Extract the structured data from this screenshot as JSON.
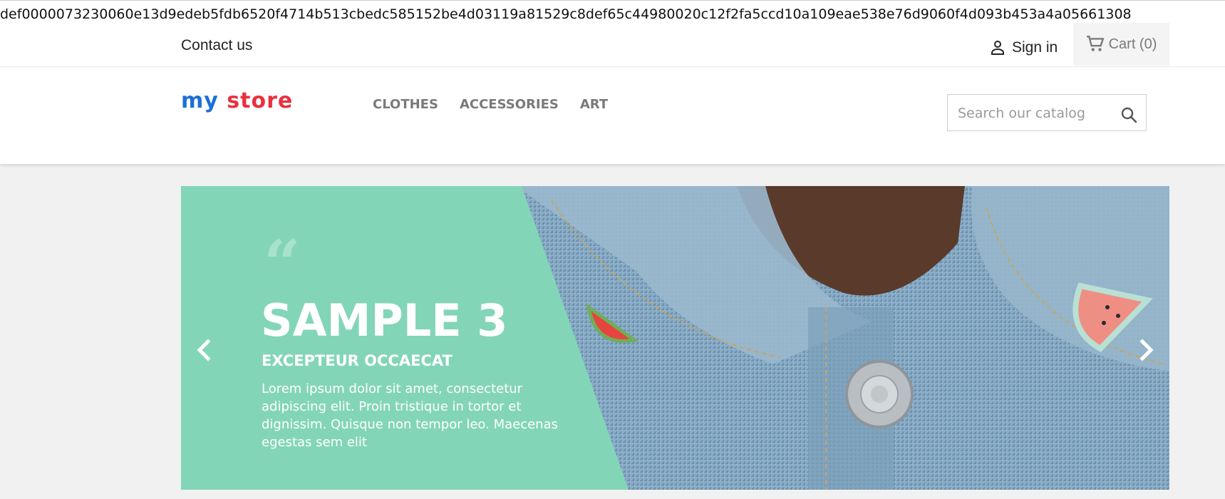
{
  "url_bar": {
    "text": "def0000073230060e13d9edeb5fdb6520f4714b513cbedc585152be4d03119a81529c8def65c44980020c12f2fa5ccd10a109eae538e76d9060f4d093b453a4a05661308"
  },
  "top_nav": {
    "contact_label": "Contact us",
    "signin_label": "Sign in",
    "cart_label": "Cart (0)"
  },
  "header": {
    "logo_part1": "my",
    "logo_part2": "store",
    "menu": [
      "CLOTHES",
      "ACCESSORIES",
      "ART"
    ],
    "search_placeholder": "Search our catalog"
  },
  "slider": {
    "title": "SAMPLE 3",
    "subtitle": "EXCEPTEUR OCCAECAT",
    "description": "Lorem ipsum dolor sit amet, consectetur adipiscing elit. Proin tristique in tortor et dignissim. Quisque non tempor leo. Maecenas egestas sem elit",
    "quote_glyph": "“"
  },
  "colors": {
    "accent_green": "#83d5b8",
    "logo_blue": "#1b6fd8",
    "logo_red": "#e9303e"
  },
  "icons": [
    "person-icon",
    "cart-icon",
    "search-icon",
    "chevron-left-icon",
    "chevron-right-icon"
  ]
}
